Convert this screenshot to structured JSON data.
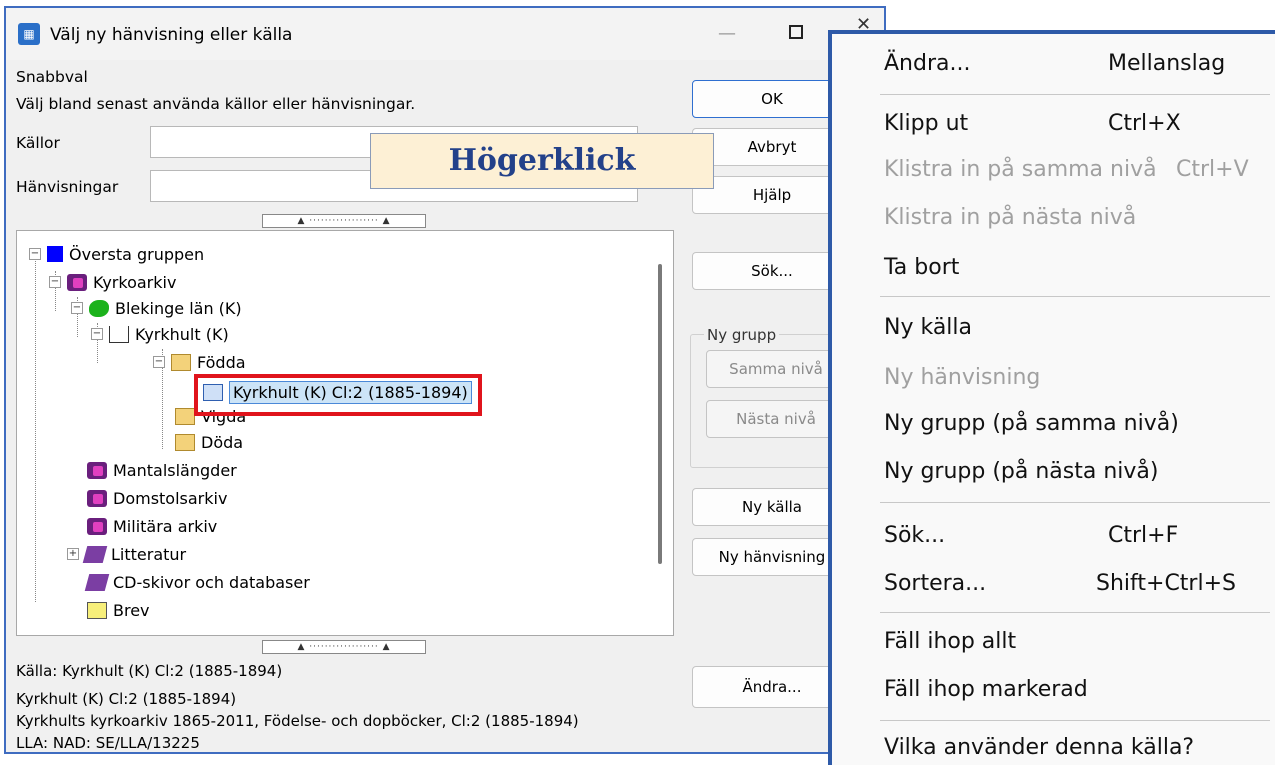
{
  "window": {
    "title": "Välj ny hänvisning eller källa",
    "minimize": "—",
    "close": "✕"
  },
  "quick": {
    "group_label": "Snabbval",
    "description": "Välj bland senast använda källor eller hänvisningar.",
    "sources_label": "Källor",
    "sources_value": "",
    "refs_label": "Hänvisningar",
    "refs_value": ""
  },
  "splitter": {
    "grip": "▲ ·················· ▲"
  },
  "tree": {
    "nodes": [
      {
        "label": "Översta gruppen",
        "icon": "blue-square-icon",
        "expander": "−"
      },
      {
        "label": "Kyrkoarkiv",
        "icon": "group-icon",
        "expander": "−"
      },
      {
        "label": "Blekinge län (K)",
        "icon": "green-map-icon",
        "expander": "−"
      },
      {
        "label": "Kyrkhult (K)",
        "icon": "house-icon",
        "expander": "−"
      },
      {
        "label": "Födda",
        "icon": "folder-icon",
        "expander": "−"
      },
      {
        "label": "Kyrkhult (K) Cl:2 (1885-1894)",
        "icon": "open-book-icon"
      },
      {
        "label": "Vigda",
        "icon": "folder-icon"
      },
      {
        "label": "Döda",
        "icon": "folder-icon"
      },
      {
        "label": "Mantalslängder",
        "icon": "group-icon"
      },
      {
        "label": "Domstolsarkiv",
        "icon": "group-icon"
      },
      {
        "label": "Militära arkiv",
        "icon": "group-icon"
      },
      {
        "label": "Litteratur",
        "icon": "book-icon",
        "expander": "+"
      },
      {
        "label": "CD-skivor och databaser",
        "icon": "book-icon"
      },
      {
        "label": "Brev",
        "icon": "envelope-icon"
      }
    ]
  },
  "info": {
    "legend": "Källa: Kyrkhult (K) Cl:2 (1885-1894)",
    "line1": "Kyrkhult (K) Cl:2 (1885-1894)",
    "line2": "Kyrkhults kyrkoarkiv 1865-2011, Födelse- och dopböcker, Cl:2 (1885-1894)",
    "line3": "LLA: NAD: SE/LLA/13225"
  },
  "buttons": {
    "ok": "OK",
    "cancel": "Avbryt",
    "help": "Hjälp",
    "search": "Sök...",
    "new_group_legend": "Ny grupp",
    "same_level": "Samma nivå",
    "next_level": "Nästa nivå",
    "new_source": "Ny källa",
    "new_reference": "Ny hänvisning",
    "edit": "Ändra..."
  },
  "annotation": {
    "text": "Högerklick"
  },
  "context_menu": {
    "items": [
      {
        "label": "Ändra...",
        "shortcut": "Mellanslag",
        "enabled": true
      },
      {
        "label": "Klipp ut",
        "shortcut": "Ctrl+X",
        "enabled": true
      },
      {
        "label": "Klistra in på samma nivå",
        "shortcut": "Ctrl+V",
        "enabled": false
      },
      {
        "label": "Klistra in på nästa nivå",
        "shortcut": "",
        "enabled": false
      },
      {
        "label": "Ta bort",
        "shortcut": "",
        "enabled": true
      },
      {
        "label": "Ny källa",
        "shortcut": "",
        "enabled": true
      },
      {
        "label": "Ny hänvisning",
        "shortcut": "",
        "enabled": false
      },
      {
        "label": "Ny grupp (på samma nivå)",
        "shortcut": "",
        "enabled": true
      },
      {
        "label": "Ny grupp (på nästa nivå)",
        "shortcut": "",
        "enabled": true
      },
      {
        "label": "Sök...",
        "shortcut": "Ctrl+F",
        "enabled": true
      },
      {
        "label": "Sortera...",
        "shortcut": "Shift+Ctrl+S",
        "enabled": true
      },
      {
        "label": "Fäll ihop allt",
        "shortcut": "",
        "enabled": true
      },
      {
        "label": "Fäll ihop markerad",
        "shortcut": "",
        "enabled": true
      },
      {
        "label": "Vilka använder denna källa?",
        "shortcut": "",
        "enabled": true
      }
    ]
  },
  "colors": {
    "accent": "#2e5aa8",
    "highlight_frame": "#e0141c",
    "selection": "#cce4f7",
    "annotation_bg": "#fdf0d5"
  }
}
